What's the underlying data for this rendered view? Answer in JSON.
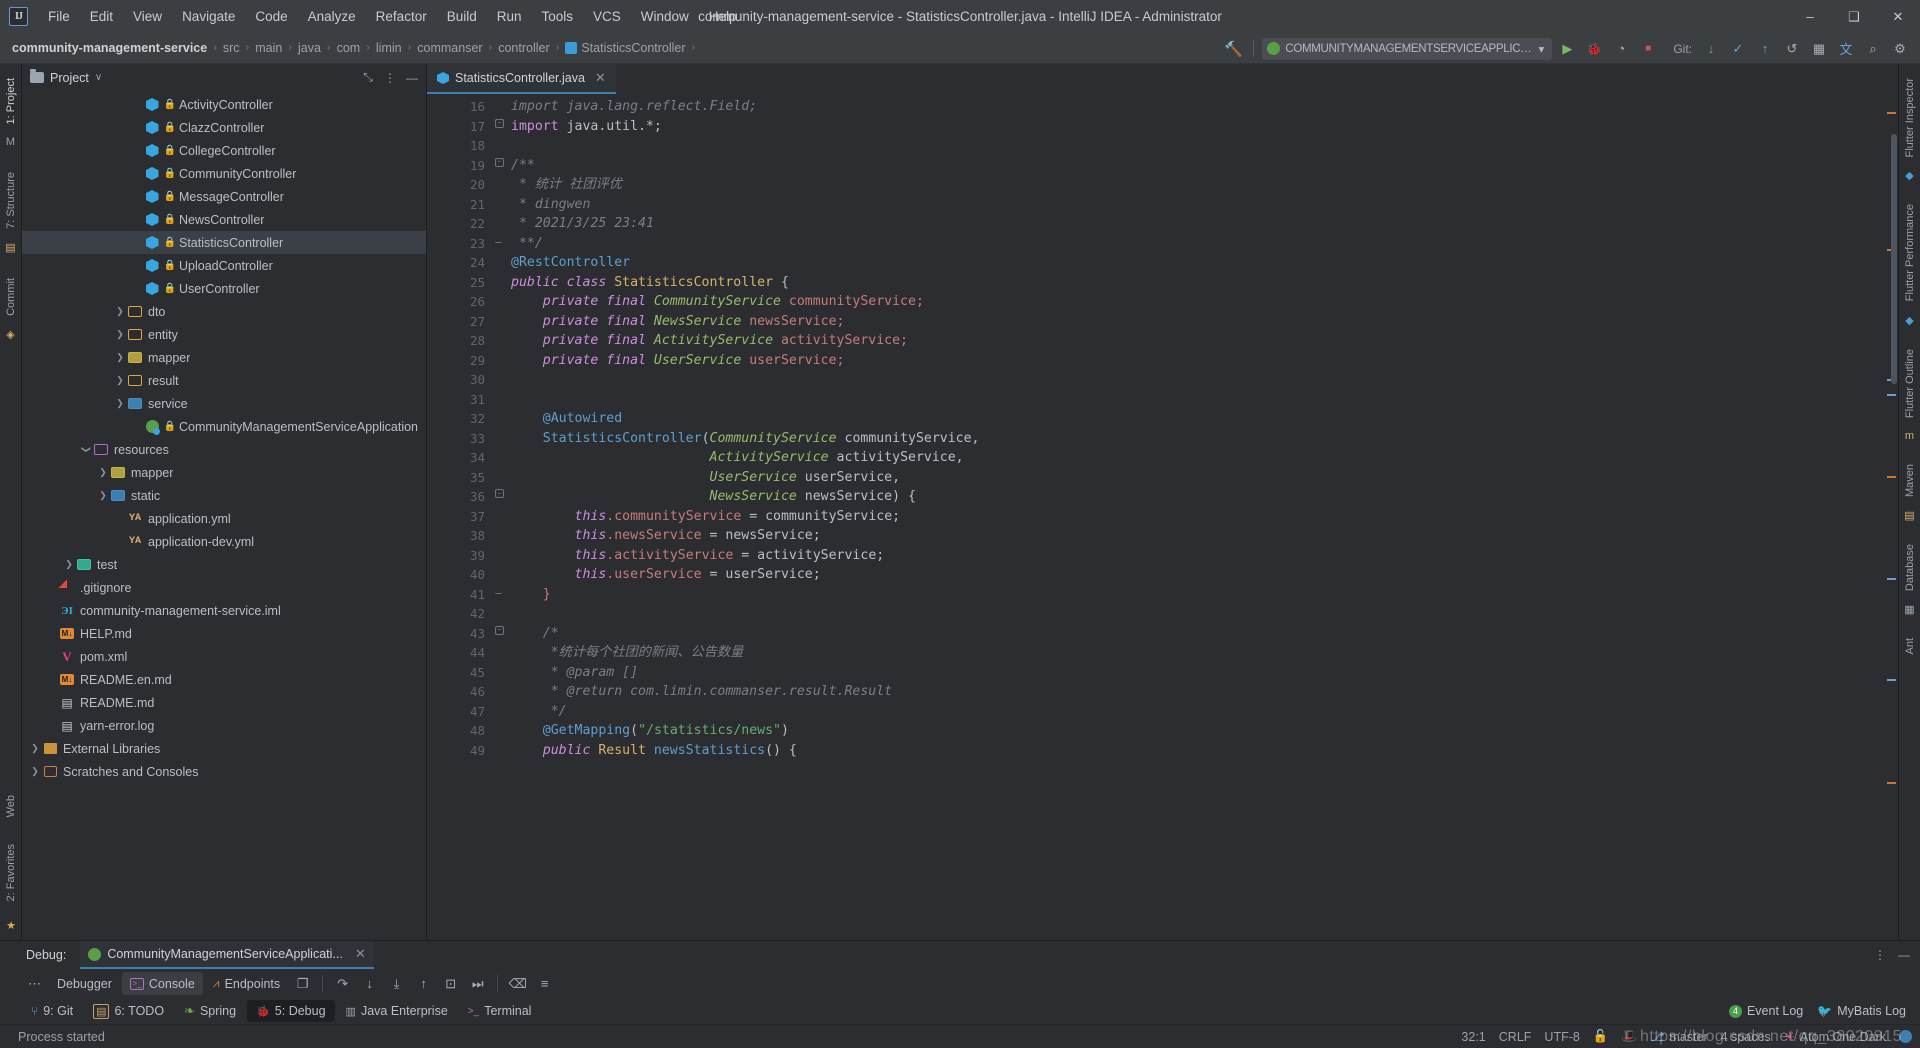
{
  "window": {
    "title": "community-management-service - StatisticsController.java - IntelliJ IDEA - Administrator",
    "logo": "IJ",
    "minimize": "–",
    "maximize": "❑",
    "close": "✕"
  },
  "menu": [
    {
      "label": "File"
    },
    {
      "label": "Edit"
    },
    {
      "label": "View"
    },
    {
      "label": "Navigate"
    },
    {
      "label": "Code"
    },
    {
      "label": "Analyze"
    },
    {
      "label": "Refactor"
    },
    {
      "label": "Build"
    },
    {
      "label": "Run"
    },
    {
      "label": "Tools"
    },
    {
      "label": "VCS"
    },
    {
      "label": "Window"
    },
    {
      "label": "Help"
    }
  ],
  "breadcrumb": {
    "items": [
      "community-management-service",
      "src",
      "main",
      "java",
      "com",
      "limin",
      "commanser",
      "controller",
      "StatisticsController"
    ],
    "separator": "›"
  },
  "toolbar": {
    "run_config": "COMMUNITYMANAGEMENTSERVICEAPPLICATION",
    "dropdown_caret": "▾",
    "run_icon": "▶",
    "debug_icon": "🐞",
    "coverage_icon": "◔",
    "stop_icon": "■",
    "git_label": "Git:",
    "update_icon": "↓",
    "commit_icon": "✓",
    "push_icon": "↑",
    "history_icon": "↺",
    "layout_icon": "▦",
    "translate_icon": "文",
    "search_icon": "⌕",
    "hammer_icon": "🔨",
    "settings_icon": "⚙"
  },
  "left_strip": {
    "tabs": [
      "1: Project",
      "7: Structure",
      "Commit"
    ],
    "bottom_tabs": [
      "2: Favorites",
      "Web"
    ],
    "maven_icon": "M"
  },
  "right_strip": {
    "tabs": [
      "Flutter Inspector",
      "Flutter Performance",
      "Flutter Outline",
      "Maven",
      "Database",
      "Ant"
    ]
  },
  "project_panel": {
    "title": "Project",
    "dropdown": "∨",
    "collapse_icon": "⤡",
    "options_icon": "⋮",
    "hide_icon": "—",
    "tree": [
      {
        "label": "ActivityController",
        "icon": "class-icon",
        "locked": true,
        "indent": 6,
        "arrow": "none"
      },
      {
        "label": "ClazzController",
        "icon": "class-icon",
        "locked": true,
        "indent": 6,
        "arrow": "none"
      },
      {
        "label": "CollegeController",
        "icon": "class-icon",
        "locked": true,
        "indent": 6,
        "arrow": "none"
      },
      {
        "label": "CommunityController",
        "icon": "class-icon",
        "locked": true,
        "indent": 6,
        "arrow": "none"
      },
      {
        "label": "MessageController",
        "icon": "class-icon",
        "locked": true,
        "indent": 6,
        "arrow": "none"
      },
      {
        "label": "NewsController",
        "icon": "class-icon",
        "locked": true,
        "indent": 6,
        "arrow": "none"
      },
      {
        "label": "StatisticsController",
        "icon": "class-icon",
        "locked": true,
        "indent": 6,
        "arrow": "none",
        "selected": true
      },
      {
        "label": "UploadController",
        "icon": "class-icon",
        "locked": true,
        "indent": 6,
        "arrow": "none"
      },
      {
        "label": "UserController",
        "icon": "class-icon",
        "locked": true,
        "indent": 6,
        "arrow": "none"
      },
      {
        "label": "dto",
        "icon": "folder-orange-icon",
        "indent": 5,
        "arrow": "collapsed"
      },
      {
        "label": "entity",
        "icon": "folder-orange-icon",
        "indent": 5,
        "arrow": "collapsed"
      },
      {
        "label": "mapper",
        "icon": "folder-yellow-icon",
        "indent": 5,
        "arrow": "collapsed"
      },
      {
        "label": "result",
        "icon": "folder-orange-icon",
        "indent": 5,
        "arrow": "collapsed"
      },
      {
        "label": "service",
        "icon": "folder-blue-icon",
        "indent": 5,
        "arrow": "collapsed"
      },
      {
        "label": "CommunityManagementServiceApplication",
        "icon": "spring-class-icon",
        "locked": true,
        "indent": 6,
        "arrow": "none"
      },
      {
        "label": "resources",
        "icon": "folder-purple-icon",
        "indent": 3,
        "arrow": "expanded"
      },
      {
        "label": "mapper",
        "icon": "folder-yellow-icon",
        "indent": 4,
        "arrow": "collapsed"
      },
      {
        "label": "static",
        "icon": "folder-blue-icon",
        "indent": 4,
        "arrow": "collapsed"
      },
      {
        "label": "application.yml",
        "icon": "yml-icon",
        "indent": 5,
        "arrow": "none"
      },
      {
        "label": "application-dev.yml",
        "icon": "yml-icon",
        "indent": 5,
        "arrow": "none"
      },
      {
        "label": "test",
        "icon": "folder-teal-icon",
        "indent": 2,
        "arrow": "collapsed"
      },
      {
        "label": ".gitignore",
        "icon": "git-icon",
        "indent": 1,
        "arrow": "none"
      },
      {
        "label": "community-management-service.iml",
        "icon": "iml-icon",
        "indent": 1,
        "arrow": "none"
      },
      {
        "label": "HELP.md",
        "icon": "markdown-icon",
        "indent": 1,
        "arrow": "none"
      },
      {
        "label": "pom.xml",
        "icon": "maven-pom-icon",
        "indent": 1,
        "arrow": "none"
      },
      {
        "label": "README.en.md",
        "icon": "markdown-icon",
        "indent": 1,
        "arrow": "none"
      },
      {
        "label": "README.md",
        "icon": "readme-icon",
        "indent": 1,
        "arrow": "none"
      },
      {
        "label": "yarn-error.log",
        "icon": "log-icon",
        "indent": 1,
        "arrow": "none"
      },
      {
        "label": "External Libraries",
        "icon": "library-icon",
        "indent": 0,
        "arrow": "collapsed"
      },
      {
        "label": "Scratches and Consoles",
        "icon": "scratch-icon",
        "indent": 0,
        "arrow": "collapsed"
      }
    ]
  },
  "editor": {
    "tab": {
      "label": "StatisticsController.java",
      "close": "✕"
    },
    "lines": [
      {
        "n": 16,
        "tokens": [
          {
            "t": "import java.lang.reflect.Field;",
            "c": "cmt"
          }
        ],
        "indent": 0
      },
      {
        "n": 17,
        "tokens": [
          {
            "t": "import ",
            "c": "kw2"
          },
          {
            "t": "java.util.*;",
            "c": "pln"
          }
        ],
        "fold": "minus"
      },
      {
        "n": 18,
        "tokens": []
      },
      {
        "n": 19,
        "tokens": [
          {
            "t": "/**",
            "c": "cmt"
          }
        ],
        "fold": "minus",
        "gmark": "book-icon"
      },
      {
        "n": 20,
        "tokens": [
          {
            "t": " * 统计 社团评优",
            "c": "cmt"
          }
        ]
      },
      {
        "n": 21,
        "tokens": [
          {
            "t": " * dingwen",
            "c": "cmt"
          }
        ]
      },
      {
        "n": 22,
        "tokens": [
          {
            "t": " * 2021/3/25 23:41",
            "c": "cmt"
          }
        ]
      },
      {
        "n": 23,
        "tokens": [
          {
            "t": " **/",
            "c": "cmt"
          }
        ],
        "fold": "end"
      },
      {
        "n": 24,
        "tokens": [
          {
            "t": "@RestController",
            "c": "mth"
          }
        ],
        "gmark": "spring-bean-icon"
      },
      {
        "n": 25,
        "tokens": [
          {
            "t": "public class ",
            "c": "kw"
          },
          {
            "t": "StatisticsController ",
            "c": "cls"
          },
          {
            "t": "{",
            "c": "pln"
          }
        ],
        "gmark": "spring-class-icon"
      },
      {
        "n": 26,
        "tokens": [
          {
            "t": "    ",
            "c": "pln"
          },
          {
            "t": "private final ",
            "c": "kw"
          },
          {
            "t": "CommunityService ",
            "c": "typ"
          },
          {
            "t": "communityService;",
            "c": "fld"
          }
        ]
      },
      {
        "n": 27,
        "tokens": [
          {
            "t": "    ",
            "c": "pln"
          },
          {
            "t": "private final ",
            "c": "kw"
          },
          {
            "t": "NewsService ",
            "c": "typ"
          },
          {
            "t": "newsService;",
            "c": "fld"
          }
        ]
      },
      {
        "n": 28,
        "tokens": [
          {
            "t": "    ",
            "c": "pln"
          },
          {
            "t": "private final ",
            "c": "kw"
          },
          {
            "t": "ActivityService ",
            "c": "typ"
          },
          {
            "t": "activityService;",
            "c": "fld"
          }
        ]
      },
      {
        "n": 29,
        "tokens": [
          {
            "t": "    ",
            "c": "pln"
          },
          {
            "t": "private final ",
            "c": "kw"
          },
          {
            "t": "UserService ",
            "c": "typ"
          },
          {
            "t": "userService;",
            "c": "fld"
          }
        ]
      },
      {
        "n": 30,
        "tokens": []
      },
      {
        "n": 31,
        "tokens": []
      },
      {
        "n": 32,
        "tokens": [
          {
            "t": "    ",
            "c": "pln"
          },
          {
            "t": "@Autowired",
            "c": "mth"
          }
        ]
      },
      {
        "n": 33,
        "tokens": [
          {
            "t": "    ",
            "c": "pln"
          },
          {
            "t": "StatisticsController",
            "c": "mth"
          },
          {
            "t": "(",
            "c": "pln"
          },
          {
            "t": "CommunityService ",
            "c": "typ"
          },
          {
            "t": "communityService,",
            "c": "pln"
          }
        ],
        "gmark": "bean-arrow-icon"
      },
      {
        "n": 34,
        "tokens": [
          {
            "t": "                         ",
            "c": "pln"
          },
          {
            "t": "ActivityService ",
            "c": "typ"
          },
          {
            "t": "activityService,",
            "c": "pln"
          }
        ],
        "gmark": "bean-arrow-icon"
      },
      {
        "n": 35,
        "tokens": [
          {
            "t": "                         ",
            "c": "pln"
          },
          {
            "t": "UserService ",
            "c": "typ"
          },
          {
            "t": "userService,",
            "c": "pln"
          }
        ],
        "gmark": "bean-arrow-icon"
      },
      {
        "n": 36,
        "tokens": [
          {
            "t": "                         ",
            "c": "pln"
          },
          {
            "t": "NewsService ",
            "c": "typ"
          },
          {
            "t": "newsService) {",
            "c": "pln"
          }
        ],
        "gmark": "bean-arrow-icon",
        "fold": "minus"
      },
      {
        "n": 37,
        "tokens": [
          {
            "t": "        ",
            "c": "pln"
          },
          {
            "t": "this",
            "c": "kw"
          },
          {
            "t": ".communityService",
            "c": "fld"
          },
          {
            "t": " = communityService;",
            "c": "pln"
          }
        ]
      },
      {
        "n": 38,
        "tokens": [
          {
            "t": "        ",
            "c": "pln"
          },
          {
            "t": "this",
            "c": "kw"
          },
          {
            "t": ".newsService",
            "c": "fld"
          },
          {
            "t": " = newsService;",
            "c": "pln"
          }
        ]
      },
      {
        "n": 39,
        "tokens": [
          {
            "t": "        ",
            "c": "pln"
          },
          {
            "t": "this",
            "c": "kw"
          },
          {
            "t": ".activityService",
            "c": "fld"
          },
          {
            "t": " = activityService;",
            "c": "pln"
          }
        ]
      },
      {
        "n": 40,
        "tokens": [
          {
            "t": "        ",
            "c": "pln"
          },
          {
            "t": "this",
            "c": "kw"
          },
          {
            "t": ".userService",
            "c": "fld"
          },
          {
            "t": " = userService;",
            "c": "pln"
          }
        ]
      },
      {
        "n": 41,
        "tokens": [
          {
            "t": "    }",
            "c": "fld"
          }
        ],
        "fold": "end"
      },
      {
        "n": 42,
        "tokens": []
      },
      {
        "n": 43,
        "tokens": [
          {
            "t": "    /*",
            "c": "cmt"
          }
        ],
        "fold": "minus"
      },
      {
        "n": 44,
        "tokens": [
          {
            "t": "     *统计每个社团的新闻、公告数量",
            "c": "cmt"
          }
        ]
      },
      {
        "n": 45,
        "tokens": [
          {
            "t": "     * @param []",
            "c": "cmt"
          }
        ]
      },
      {
        "n": 46,
        "tokens": [
          {
            "t": "     * @return com.limin.commanser.result.Result",
            "c": "cmt"
          }
        ]
      },
      {
        "n": 47,
        "tokens": [
          {
            "t": "     */",
            "c": "cmt"
          }
        ]
      },
      {
        "n": 48,
        "tokens": [
          {
            "t": "    ",
            "c": "pln"
          },
          {
            "t": "@GetMapping",
            "c": "mth"
          },
          {
            "t": "(",
            "c": "pln"
          },
          {
            "t": "\"/statistics/news\"",
            "c": "str"
          },
          {
            "t": ")",
            "c": "pln"
          }
        ]
      },
      {
        "n": 49,
        "tokens": [
          {
            "t": "    ",
            "c": "pln"
          },
          {
            "t": "public ",
            "c": "kw"
          },
          {
            "t": "Result ",
            "c": "cls"
          },
          {
            "t": "newsStatistics",
            "c": "mth"
          },
          {
            "t": "() {",
            "c": "pln"
          }
        ],
        "gmark": "spring-url-icon"
      }
    ]
  },
  "debug_panel": {
    "label": "Debug:",
    "session_tab": "CommunityManagementServiceApplicati...",
    "session_close": "✕",
    "settings_icon": "⋮",
    "hide_icon": "—",
    "overflow_icon": "⋯",
    "tabs": [
      {
        "label": "Debugger",
        "icon": "debugger-icon",
        "active": false
      },
      {
        "label": "Console",
        "icon": "console-icon",
        "active": true
      },
      {
        "label": "Endpoints",
        "icon": "endpoints-icon",
        "active": false
      }
    ],
    "actions": [
      {
        "name": "frames-icon",
        "glyph": "❐"
      },
      {
        "name": "step-over-icon",
        "glyph": "↷"
      },
      {
        "name": "step-into-icon",
        "glyph": "↓"
      },
      {
        "name": "force-step-into-icon",
        "glyph": "⤓"
      },
      {
        "name": "step-out-icon",
        "glyph": "↑"
      },
      {
        "name": "drop-frame-icon",
        "glyph": "⊡"
      },
      {
        "name": "run-to-cursor-icon",
        "glyph": "⏭"
      },
      {
        "name": "evaluate-icon",
        "glyph": "⌫"
      },
      {
        "name": "settings-list-icon",
        "glyph": "≡"
      }
    ]
  },
  "bottom_tabs": [
    {
      "label": "9: Git",
      "icon": "git-branch-icon",
      "active": false
    },
    {
      "label": "6: TODO",
      "icon": "todo-icon",
      "active": false
    },
    {
      "label": "Spring",
      "icon": "spring-leaf-icon",
      "active": false
    },
    {
      "label": "5: Debug",
      "icon": "debug-bug-icon",
      "active": true
    },
    {
      "label": "Java Enterprise",
      "icon": "java-ee-icon",
      "active": false
    },
    {
      "label": "Terminal",
      "icon": "terminal-icon",
      "active": false
    }
  ],
  "bottom_right": [
    {
      "label": "Event Log",
      "icon": "event-log-icon"
    },
    {
      "label": "MyBatis Log",
      "icon": "mybatis-log-icon"
    }
  ],
  "statusbar": {
    "message": "Process started",
    "caret": "32:1",
    "line_separator": "CRLF",
    "encoding": "UTF-8",
    "lock_icon": "🔓",
    "inspection_icon": "🎩",
    "branch_icon": "⎇",
    "branch": "master",
    "indent": "4 spaces",
    "theme_icon": "☀",
    "theme": "Atom One Dark",
    "watermark": "https://blog.csdn.net/qq_38020915"
  },
  "colors": {
    "accent": "#3d7fae",
    "background": "#2b2d30",
    "panel": "#3c3f41",
    "selection": "#3b3f47",
    "text": "#bcbec4",
    "keyword": "#cf8ee0",
    "string": "#6aab73",
    "comment": "#7a7e87",
    "annotation": "#5f9ecf",
    "class_name": "#d6b36a",
    "field": "#c77b7b",
    "type": "#98bb6c"
  }
}
